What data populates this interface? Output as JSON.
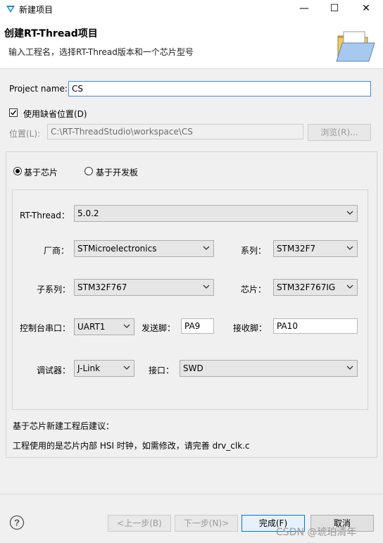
{
  "window": {
    "title": "新建项目",
    "controls": {
      "minimize": "—",
      "maximize": "☐",
      "close": "✕"
    }
  },
  "header": {
    "title": "创建RT-Thread项目",
    "description": "输入工程名，选择RT-Thread版本和一个芯片型号"
  },
  "project": {
    "name_label": "Project name:",
    "name_value": "CS",
    "default_location_label": "使用缺省位置(D)",
    "default_location_checked": true,
    "location_label": "位置(L):",
    "location_value": "C:\\RT-ThreadStudio\\workspace\\CS",
    "browse_label": "浏览(R)..."
  },
  "mode": {
    "chip_label": "基于芯片",
    "board_label": "基于开发板",
    "selected": "chip"
  },
  "config": {
    "rtthread_label": "RT-Thread：",
    "rtthread_value": "5.0.2",
    "vendor_label": "厂商：",
    "vendor_value": "STMicroelectronics",
    "series_label": "系列：",
    "series_value": "STM32F7",
    "subseries_label": "子系列：",
    "subseries_value": "STM32F767",
    "chip_label": "芯片：",
    "chip_value": "STM32F767IG",
    "uart_label": "控制台串口：",
    "uart_value": "UART1",
    "tx_label": "发送脚：",
    "tx_value": "PA9",
    "rx_label": "接收脚：",
    "rx_value": "PA10",
    "debugger_label": "调试器：",
    "debugger_value": "J-Link",
    "interface_label": "接口：",
    "interface_value": "SWD"
  },
  "advice": {
    "title": "基于芯片新建工程后建议：",
    "text": "工程使用的是芯片内部 HSI 时钟，如需修改，请完善 drv_clk.c"
  },
  "footer": {
    "help_icon": "?",
    "back_label": "<上一步(B)",
    "next_label": "下一步(N)>",
    "finish_label": "完成(F)",
    "cancel_label": "取消",
    "watermark": "CSDN @琥珀清年"
  },
  "colors": {
    "focus_border": "#3d8ee0",
    "primary_border": "#0078d7",
    "background": "#f0f0f0"
  }
}
